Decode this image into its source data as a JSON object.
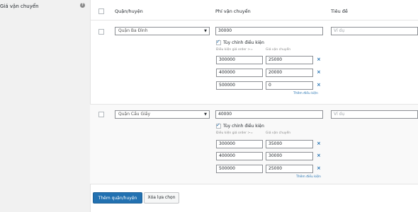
{
  "row_label": "Giá vận chuyển",
  "help_icon": "?",
  "columns": {
    "district": "Quận/huyện",
    "fee": "Phí vận chuyển",
    "title": "Tiêu đề"
  },
  "custom_label": "Tùy chỉnh điều kiện",
  "cond_headers": {
    "min_order": "Điều kiện giá order >=",
    "fee": "Giá vận chuyển"
  },
  "zones": [
    {
      "district": "Quận Ba Đình",
      "fee": "30000",
      "title_placeholder": "Ví dụ",
      "conditions": [
        {
          "min": "300000",
          "fee": "25000"
        },
        {
          "min": "400000",
          "fee": "20000"
        },
        {
          "min": "500000",
          "fee": "0"
        }
      ],
      "more_link": "Thêm điều kiện"
    },
    {
      "district": "Quận Cầu Giấy",
      "fee": "40000",
      "title_placeholder": "Ví dụ",
      "conditions": [
        {
          "min": "300000",
          "fee": "35000"
        },
        {
          "min": "400000",
          "fee": "30000"
        },
        {
          "min": "500000",
          "fee": "25000"
        }
      ],
      "more_link": "Thêm điều kiện"
    }
  ],
  "remove_symbol": "×",
  "check_symbol": "✓",
  "buttons": {
    "add": "Thêm quận/huyện",
    "delete": "Xóa lựa chọn"
  },
  "colors": {
    "accent": "#2271b1",
    "panel": "#ffffff",
    "background": "#f1f1f1"
  }
}
